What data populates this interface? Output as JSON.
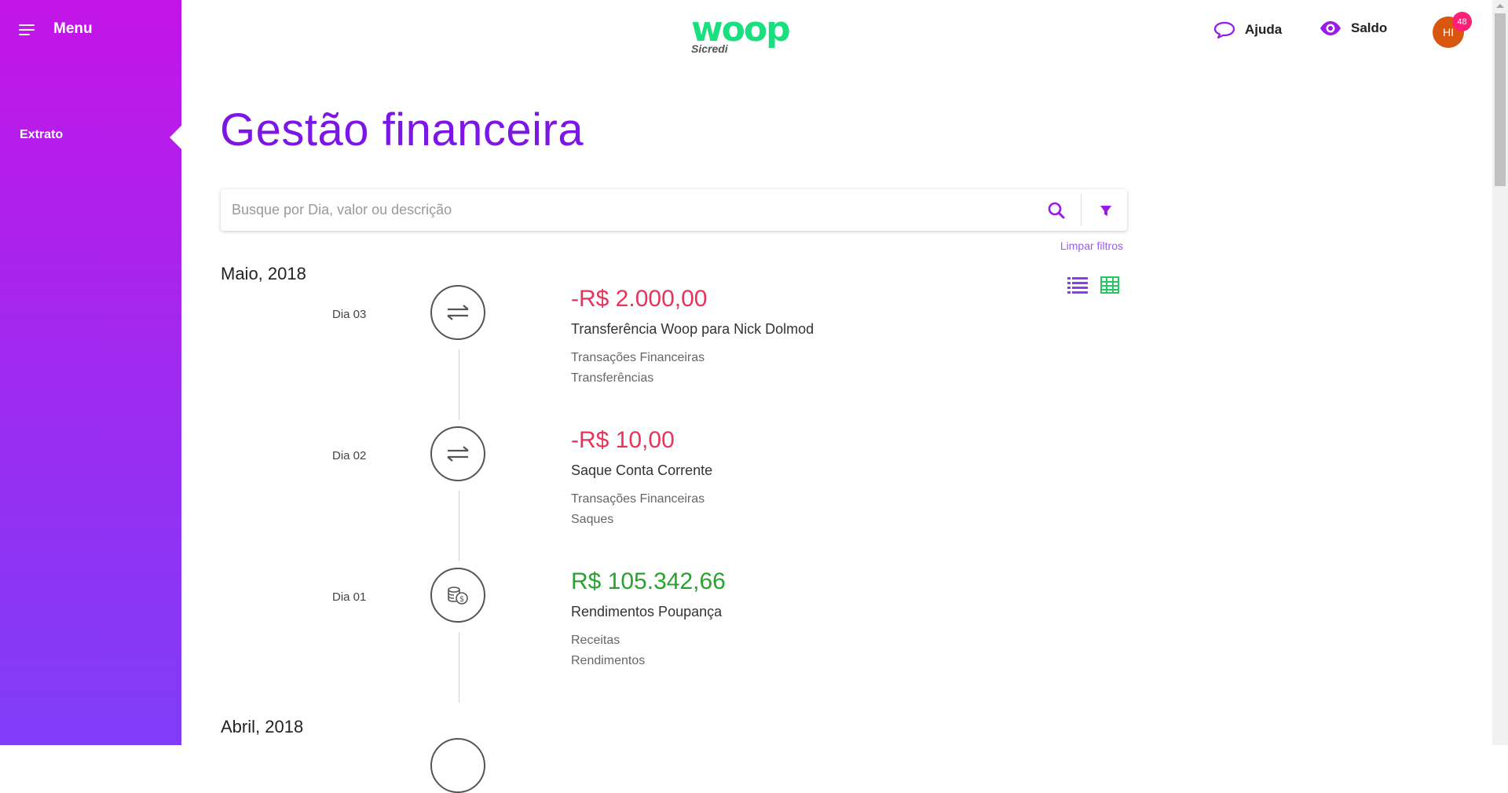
{
  "sidebar": {
    "menu_label": "Menu",
    "items": [
      {
        "label": "Extrato",
        "active": true
      }
    ],
    "gradient": [
      "#c414e8",
      "#7f3df8"
    ]
  },
  "header": {
    "logo_word": "woop",
    "logo_sub": "Sicredi",
    "help_label": "Ajuda",
    "balance_label": "Saldo",
    "avatar_initials": "HI",
    "notification_count": "48",
    "accent_color": "#9b19ea",
    "logo_color": "#18e07e"
  },
  "main": {
    "title": "Gestão financeira",
    "search": {
      "placeholder": "Busque por Dia, valor ou descrição",
      "value": ""
    },
    "clear_filters": "Limpar filtros",
    "view_modes": [
      "list-icon",
      "table-icon"
    ],
    "months": [
      {
        "label": "Maio, 2018",
        "transactions": [
          {
            "day": "Dia 03",
            "icon": "transfer-icon",
            "amount": "-R$ 2.000,00",
            "description": "Transferência Woop para Nick Dolmod",
            "category": "Transações Financeiras",
            "subcategory": "Transferências"
          },
          {
            "day": "Dia 02",
            "icon": "transfer-icon",
            "amount": "-R$ 10,00",
            "description": "Saque Conta Corrente",
            "category": "Transações Financeiras",
            "subcategory": "Saques"
          },
          {
            "day": "Dia 01",
            "icon": "coins-icon",
            "amount": "R$ 105.342,66",
            "description": "Rendimentos Poupança",
            "category": "Receitas",
            "subcategory": "Rendimentos"
          }
        ]
      },
      {
        "label": "Abril, 2018",
        "transactions": []
      }
    ],
    "negative_color": "#e8345a",
    "positive_color": "#2aa22e"
  }
}
